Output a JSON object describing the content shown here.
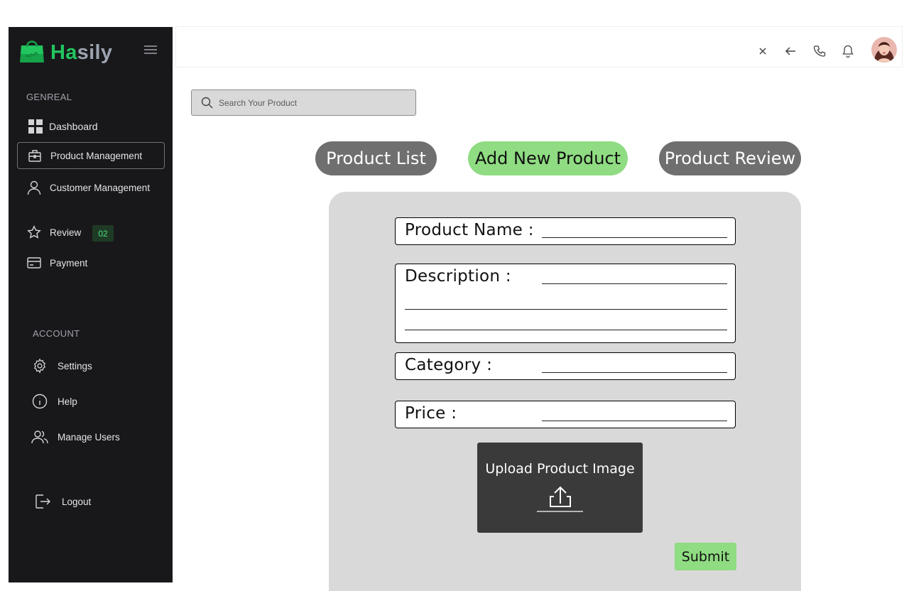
{
  "brand": {
    "name_part1": "Ha",
    "name_part2": "sily",
    "accent": "#22c55e"
  },
  "sidebar": {
    "general_label": "GENREAL",
    "account_label": "ACCOUNT",
    "items": [
      {
        "label": "Dashboard",
        "icon": "grid-icon"
      },
      {
        "label": "Product Management",
        "icon": "briefcase-icon",
        "active": true
      },
      {
        "label": "Customer Management",
        "icon": "user-icon"
      },
      {
        "label": "Review",
        "icon": "star-icon",
        "badge": "02"
      },
      {
        "label": "Payment",
        "icon": "credit-card-icon"
      }
    ],
    "account_items": [
      {
        "label": "Settings",
        "icon": "gear-icon"
      },
      {
        "label": "Help",
        "icon": "info-icon"
      },
      {
        "label": "Manage Users",
        "icon": "users-icon"
      },
      {
        "label": "Logout",
        "icon": "logout-icon"
      }
    ]
  },
  "topbar": {
    "icons": [
      "close-icon",
      "back-arrow-icon",
      "phone-icon",
      "bell-icon",
      "avatar"
    ]
  },
  "search": {
    "placeholder": "Search Your Product"
  },
  "tabs": [
    {
      "label": "Product List",
      "color": "#6f6f6f"
    },
    {
      "label": "Add New Product",
      "color": "#8fdc82",
      "selected": true
    },
    {
      "label": "Product Review",
      "color": "#6f6f6f"
    }
  ],
  "form": {
    "product_name_label": "Product Name :",
    "description_label": "Description :",
    "category_label": "Category :",
    "price_label": "Price :",
    "upload_label": "Upload Product Image",
    "submit_label": "Submit"
  }
}
